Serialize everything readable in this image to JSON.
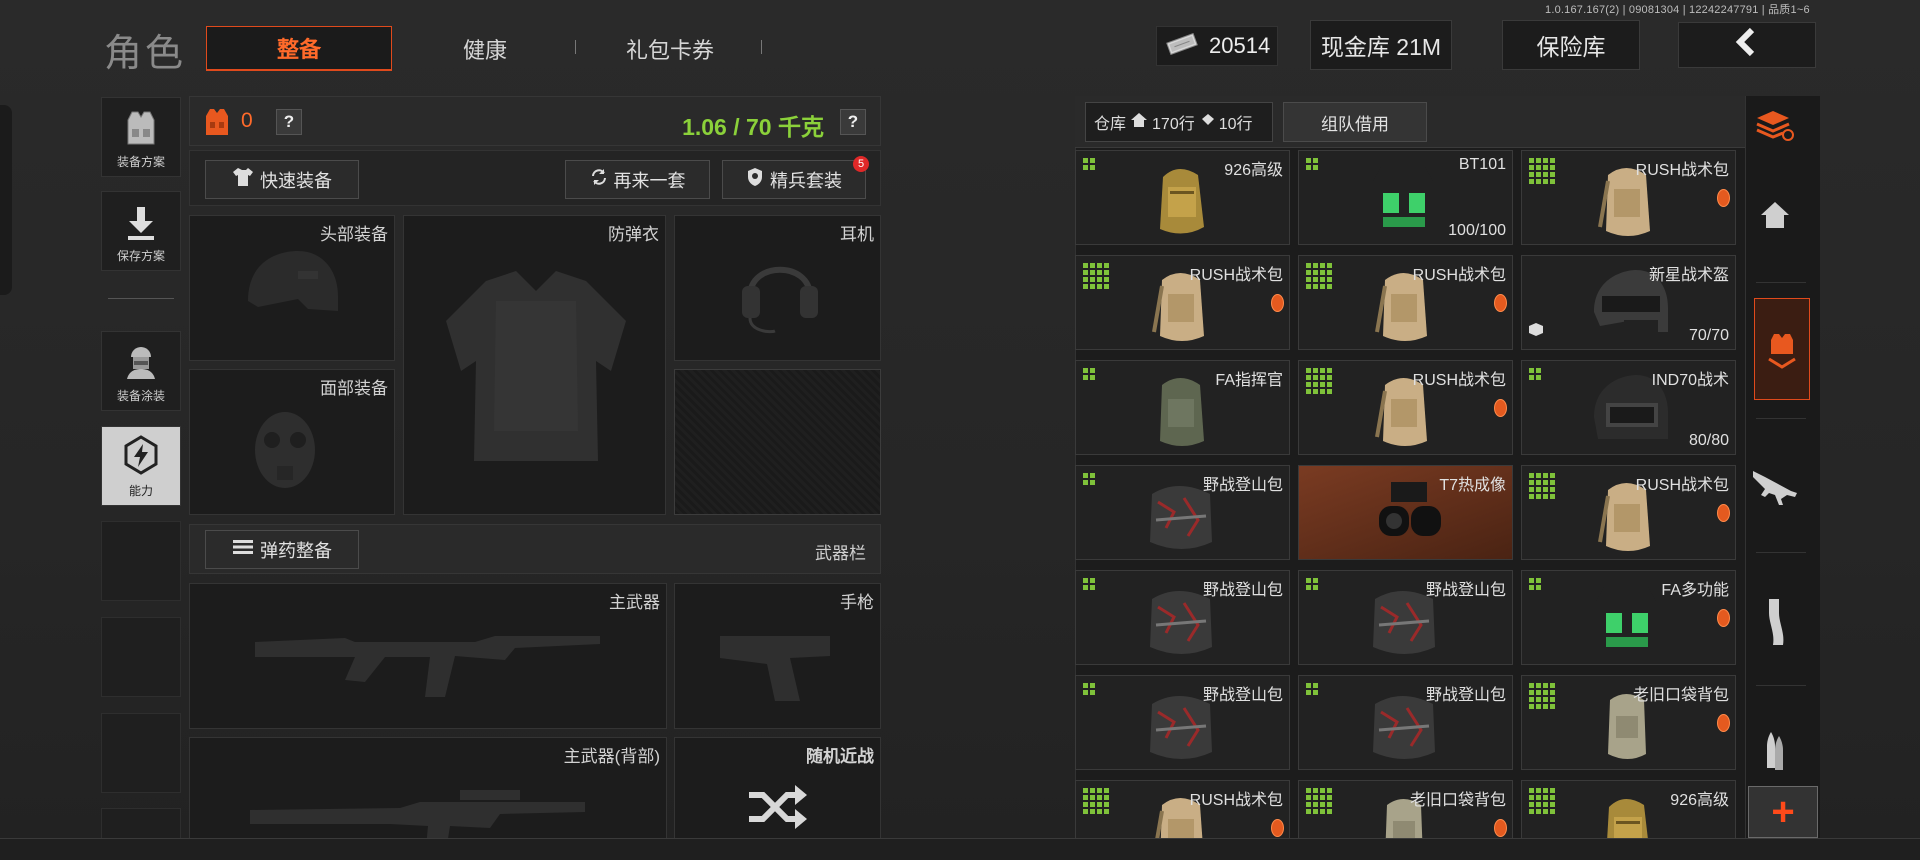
{
  "version": "1.0.167.167(2) | 09081304 | 12242247791 | 品质1~6",
  "header": {
    "title": "角色",
    "tabs": [
      {
        "label": "整备",
        "active": true
      },
      {
        "label": "健康",
        "active": false
      },
      {
        "label": "礼包卡券",
        "active": false
      }
    ],
    "currency": "20514",
    "cash_vault": "现金库 21M",
    "safe": "保险库"
  },
  "sidebar": {
    "items": [
      {
        "label": "装备方案",
        "icon": "vest-icon"
      },
      {
        "label": "保存方案",
        "icon": "download-icon"
      },
      {
        "label": "装备涂装",
        "icon": "soldier-icon"
      },
      {
        "label": "能力",
        "icon": "ability-icon",
        "selected": true
      }
    ]
  },
  "loadout": {
    "armor_count": "0",
    "weight": "1.06 / 70 千克",
    "help": "?",
    "quick_equip": "快速装备",
    "reroll": "再来一套",
    "elite_set": "精兵套装",
    "elite_badge": "5",
    "slots": {
      "head": "头部装备",
      "armor": "防弹衣",
      "headset": "耳机",
      "face": "面部装备",
      "primary": "主武器",
      "pistol": "手枪",
      "primary_back": "主武器(背部)",
      "melee": "随机近战"
    },
    "ammo_button": "弹药整备",
    "weapon_bar": "武器栏"
  },
  "storage": {
    "label": "仓库",
    "rows_home": "170行",
    "rows_ticket": "10行",
    "team_borrow": "组队借用",
    "items": [
      {
        "name": "926高级",
        "grid": 4,
        "kind": "bag-gold"
      },
      {
        "name": "BT101",
        "grid": 4,
        "kind": "vest-green",
        "durability": "100/100"
      },
      {
        "name": "RUSH战术包",
        "grid": 16,
        "kind": "bag-tan",
        "badge": true
      },
      {
        "name": "RUSH战术包",
        "grid": 16,
        "kind": "bag-tan",
        "badge": true
      },
      {
        "name": "RUSH战术包",
        "grid": 16,
        "kind": "bag-tan",
        "badge": true
      },
      {
        "name": "新星战术盔",
        "grid": 0,
        "kind": "helmet-dark",
        "durability": "70/70",
        "box": true
      },
      {
        "name": "FA指挥官",
        "grid": 4,
        "kind": "bag-olive"
      },
      {
        "name": "RUSH战术包",
        "grid": 16,
        "kind": "bag-tan",
        "badge": true
      },
      {
        "name": "IND70战术",
        "grid": 4,
        "kind": "helmet-black",
        "durability": "80/80"
      },
      {
        "name": "野战登山包",
        "grid": 4,
        "kind": "bag-camo"
      },
      {
        "name": "T7热成像",
        "grid": 0,
        "kind": "nvg",
        "highlight": true
      },
      {
        "name": "RUSH战术包",
        "grid": 16,
        "kind": "bag-tan",
        "badge": true
      },
      {
        "name": "野战登山包",
        "grid": 4,
        "kind": "bag-camo"
      },
      {
        "name": "野战登山包",
        "grid": 4,
        "kind": "bag-camo"
      },
      {
        "name": "FA多功能",
        "grid": 4,
        "kind": "vest-green",
        "badge": true
      },
      {
        "name": "野战登山包",
        "grid": 4,
        "kind": "bag-camo"
      },
      {
        "name": "野战登山包",
        "grid": 4,
        "kind": "bag-camo"
      },
      {
        "name": "老旧口袋背包",
        "grid": 16,
        "kind": "bag-khaki",
        "badge": true
      },
      {
        "name": "RUSH战术包",
        "grid": 16,
        "kind": "bag-tan",
        "badge": true
      },
      {
        "name": "老旧口袋背包",
        "grid": 16,
        "kind": "bag-khaki",
        "badge": true
      },
      {
        "name": "926高级",
        "grid": 16,
        "kind": "bag-gold"
      }
    ]
  },
  "right_nav": {
    "items": [
      "layers-icon",
      "home-icon",
      "loot-icon",
      "rifle-icon",
      "magazine-icon",
      "ammo-icon"
    ],
    "add": "+"
  },
  "colors": {
    "accent": "#e04a1c",
    "weight_green": "#8bd13a",
    "grid_green": "#7fc23a"
  }
}
